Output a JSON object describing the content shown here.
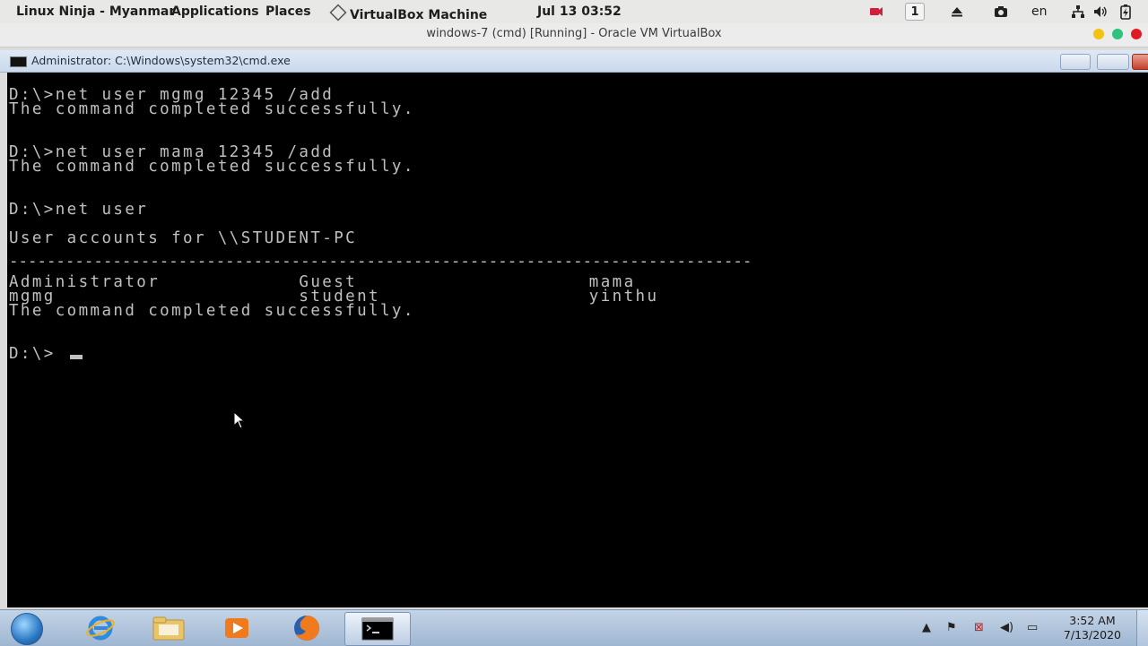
{
  "topbar": {
    "activities": "Linux Ninja - Myanmar",
    "applications": "Applications",
    "places": "Places",
    "app_menu": "VirtualBox Machine",
    "clock": "Jul 13  03:52",
    "workspace": "1",
    "language": "en"
  },
  "vbox": {
    "title": "windows-7 (cmd) [Running] - Oracle VM VirtualBox"
  },
  "cmd": {
    "title": "Administrator: C:\\Windows\\system32\\cmd.exe",
    "lines": [
      "D:\\>net user mgmg 12345 /add",
      "The command completed successfully.",
      "D:\\>net user mama 12345 /add",
      "The command completed successfully.",
      "D:\\>net user",
      "User accounts for \\\\STUDENT-PC",
      "-------------------------------------------------------------------------------",
      "Administrator            Guest                    mama",
      "mgmg                     student                  yinthu",
      "The command completed successfully.",
      "D:\\>"
    ]
  },
  "taskbar": {
    "time": "3:52 AM",
    "date": "7/13/2020"
  }
}
